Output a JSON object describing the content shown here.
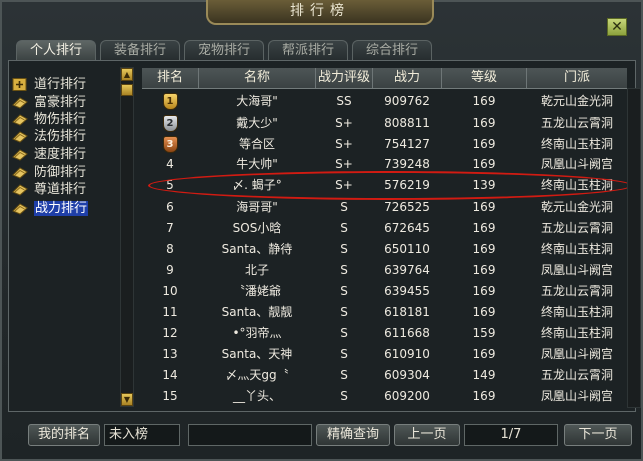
{
  "window": {
    "title": "排行榜",
    "close_glyph": "✕"
  },
  "tabs": [
    {
      "label": "个人排行",
      "active": true
    },
    {
      "label": "装备排行",
      "active": false
    },
    {
      "label": "宠物排行",
      "active": false
    },
    {
      "label": "帮派排行",
      "active": false
    },
    {
      "label": "综合排行",
      "active": false
    }
  ],
  "sidebar": {
    "items": [
      {
        "label": "道行排行",
        "icon": "plus-square-icon",
        "active": false
      },
      {
        "label": "富豪排行",
        "icon": "scroll-icon",
        "active": false
      },
      {
        "label": "物伤排行",
        "icon": "scroll-icon",
        "active": false
      },
      {
        "label": "法伤排行",
        "icon": "scroll-icon",
        "active": false
      },
      {
        "label": "速度排行",
        "icon": "scroll-icon",
        "active": false
      },
      {
        "label": "防御排行",
        "icon": "scroll-icon",
        "active": false
      },
      {
        "label": "尊道排行",
        "icon": "scroll-icon",
        "active": false
      },
      {
        "label": "战力排行",
        "icon": "scroll-icon",
        "active": true
      }
    ]
  },
  "table": {
    "headers": [
      "排名",
      "名称",
      "战力评级",
      "战力",
      "等级",
      "门派"
    ],
    "rows": [
      {
        "rank": "1",
        "name": "大海哥\"",
        "grade": "SS",
        "power": "909762",
        "level": "169",
        "sect": "乾元山金光洞"
      },
      {
        "rank": "2",
        "name": "戴大少\"",
        "grade": "S+",
        "power": "808811",
        "level": "169",
        "sect": "五龙山云霄洞"
      },
      {
        "rank": "3",
        "name": "等合区",
        "grade": "S+",
        "power": "754127",
        "level": "169",
        "sect": "终南山玉柱洞"
      },
      {
        "rank": "4",
        "name": "牛大帅\"",
        "grade": "S+",
        "power": "739248",
        "level": "169",
        "sect": "凤凰山斗阙宫"
      },
      {
        "rank": "5",
        "name": "〆. 蝎子°",
        "grade": "S+",
        "power": "576219",
        "level": "139",
        "sect": "终南山玉柱洞"
      },
      {
        "rank": "6",
        "name": "海哥哥\"",
        "grade": "S",
        "power": "726525",
        "level": "169",
        "sect": "乾元山金光洞"
      },
      {
        "rank": "7",
        "name": "SOS小晗",
        "grade": "S",
        "power": "672645",
        "level": "169",
        "sect": "五龙山云霄洞"
      },
      {
        "rank": "8",
        "name": "Santa、静待",
        "grade": "S",
        "power": "650110",
        "level": "169",
        "sect": "终南山玉柱洞"
      },
      {
        "rank": "9",
        "name": "北子",
        "grade": "S",
        "power": "639764",
        "level": "169",
        "sect": "凤凰山斗阙宫"
      },
      {
        "rank": "10",
        "name": "〝潘姥爺",
        "grade": "S",
        "power": "639455",
        "level": "169",
        "sect": "五龙山云霄洞"
      },
      {
        "rank": "11",
        "name": "Santa、靓靓",
        "grade": "S",
        "power": "618181",
        "level": "169",
        "sect": "终南山玉柱洞"
      },
      {
        "rank": "12",
        "name": "•°羽帝灬",
        "grade": "S",
        "power": "611668",
        "level": "159",
        "sect": "终南山玉柱洞"
      },
      {
        "rank": "13",
        "name": "Santa、天神",
        "grade": "S",
        "power": "610910",
        "level": "169",
        "sect": "凤凰山斗阙宫"
      },
      {
        "rank": "14",
        "name": "〆灬天gg〝",
        "grade": "S",
        "power": "609304",
        "level": "149",
        "sect": "五龙山云霄洞"
      },
      {
        "rank": "15",
        "name": "__丫头、",
        "grade": "S",
        "power": "609200",
        "level": "169",
        "sect": "凤凰山斗阙宫"
      }
    ]
  },
  "bottom": {
    "my_rank_label": "我的排名",
    "my_rank_value": "未入榜",
    "search_value": "",
    "search_button": "精确查询",
    "prev_button": "上一页",
    "page_indicator": "1/7",
    "next_button": "下一页"
  },
  "colors": {
    "highlight_circle": "#d21b12",
    "active_category_bg": "#1f3fa8",
    "medal_gold": "#d9a92a",
    "medal_silver": "#c4c8cc",
    "medal_bronze": "#c06a2a"
  }
}
